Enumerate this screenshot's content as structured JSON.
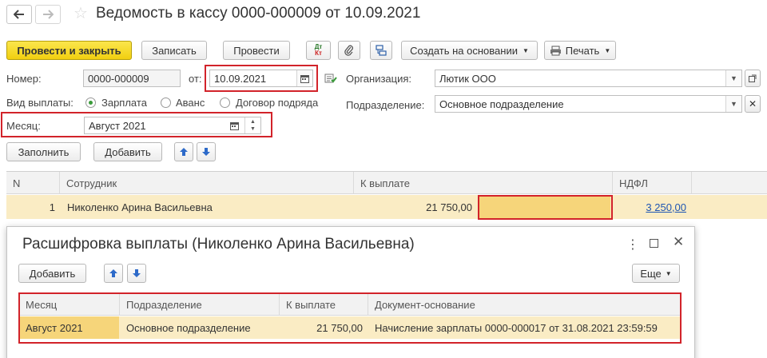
{
  "window": {
    "title": "Ведомость в кассу 0000-000009 от 10.09.2021"
  },
  "toolbar": {
    "post_close": "Провести и закрыть",
    "save": "Записать",
    "post": "Провести",
    "dtkt_top": "Дт",
    "dtkt_bottom": "Кт",
    "create_based": "Создать на основании",
    "print": "Печать"
  },
  "form": {
    "number_label": "Номер:",
    "number_value": "0000-000009",
    "date_label": "от:",
    "date_value": "10.09.2021",
    "org_label": "Организация:",
    "org_value": "Лютик ООО",
    "payout_label": "Вид выплаты:",
    "payout_options": [
      "Зарплата",
      "Аванс",
      "Договор подряда"
    ],
    "dept_label": "Подразделение:",
    "dept_value": "Основное подразделение",
    "month_label": "Месяц:",
    "month_value": "Август 2021"
  },
  "table_toolbar": {
    "fill": "Заполнить",
    "add": "Добавить"
  },
  "table": {
    "headers": [
      "N",
      "Сотрудник",
      "К выплате",
      "НДФЛ"
    ],
    "rows": [
      {
        "n": "1",
        "employee": "Николенко Арина Васильевна",
        "amount": "21 750,00",
        "ndfl": "3 250,00"
      }
    ]
  },
  "popup": {
    "title": "Расшифровка выплаты (Николенко Арина Васильевна)",
    "add": "Добавить",
    "more": "Еще",
    "headers": [
      "Месяц",
      "Подразделение",
      "К выплате",
      "Документ-основание"
    ],
    "rows": [
      {
        "month": "Август 2021",
        "dept": "Основное подразделение",
        "amount": "21 750,00",
        "doc": "Начисление зарплаты 0000-000017 от 31.08.2021 23:59:59"
      }
    ]
  },
  "colors": {
    "accent_yellow": "#f4d220",
    "highlight_red": "#d2232a",
    "row_selected": "#faecc4",
    "link_blue": "#1f56b3"
  }
}
